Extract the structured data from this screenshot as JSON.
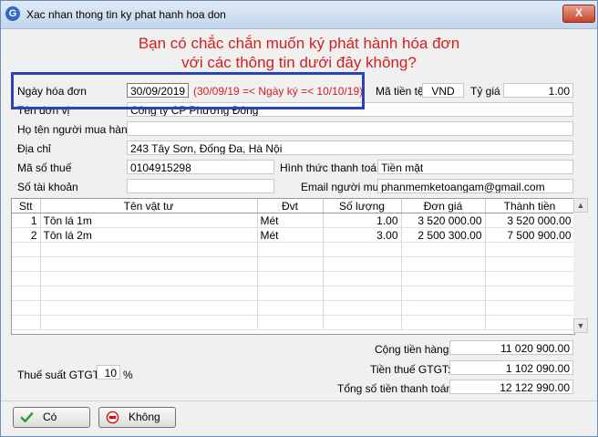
{
  "window": {
    "title": "Xac nhan thong tin ky phat hanh hoa don",
    "close_label": "X"
  },
  "headline": {
    "line1": "Bạn có chắc chắn muốn ký phát hành hóa đơn",
    "line2": "với các thông tin dưới đây không?"
  },
  "form": {
    "invoice_date_label": "Ngày hóa đơn",
    "invoice_date_value": "30/09/2019",
    "date_range_note": "(30/09/19 =< Ngày ký =< 10/10/19)",
    "currency_label": "Mã tiền tệ",
    "currency_value": "VND",
    "rate_label": "Tỷ giá",
    "rate_value": "1.00",
    "unit_name_label": "Tên đơn vị",
    "unit_name_value": "Công ty CP Phương Đông",
    "buyer_name_label": "Họ tên người mua hàng",
    "buyer_name_value": "",
    "address_label": "Địa chỉ",
    "address_value": "243 Tây Sơn, Đống Đa, Hà Nội",
    "tax_code_label": "Mã số thuế",
    "tax_code_value": "0104915298",
    "payment_method_label": "Hình thức thanh toán",
    "payment_method_value": "Tiền mặt",
    "account_label": "Số tài khoản",
    "account_value": "",
    "buyer_email_label": "Email người mua",
    "buyer_email_value": "phanmemketoangam@gmail.com"
  },
  "table": {
    "headers": [
      "Stt",
      "Tên vật tư",
      "Đvt",
      "Số lượng",
      "Đơn giá",
      "Thành tiền"
    ],
    "rows": [
      [
        "1",
        "Tôn lá 1m",
        "Mét",
        "1.00",
        "3 520 000.00",
        "3 520 000.00"
      ],
      [
        "2",
        "Tôn lá 2m",
        "Mét",
        "3.00",
        "2 500 300.00",
        "7 500 900.00"
      ]
    ]
  },
  "totals": {
    "subtotal_label": "Cộng tiền hàng:",
    "subtotal_value": "11 020 900.00",
    "vat_amount_label": "Tiền thuế GTGT:",
    "vat_amount_value": "1 102 090.00",
    "grand_total_label": "Tổng số tiền thanh toán:",
    "grand_total_value": "12 122 990.00",
    "vat_rate_label": "Thuế suất GTGT:",
    "vat_rate_value": "10",
    "vat_rate_unit": "%"
  },
  "buttons": {
    "yes_label": "Có",
    "no_label": "Không"
  },
  "colors": {
    "headline": "#d31f1f",
    "highlight_frame": "#2b43b8",
    "yes_icon": "#2e9b2e",
    "no_icon": "#c8141e"
  },
  "icons": {
    "app": "app-logo-icon",
    "yes": "checkmark-icon",
    "no": "stop-icon"
  }
}
